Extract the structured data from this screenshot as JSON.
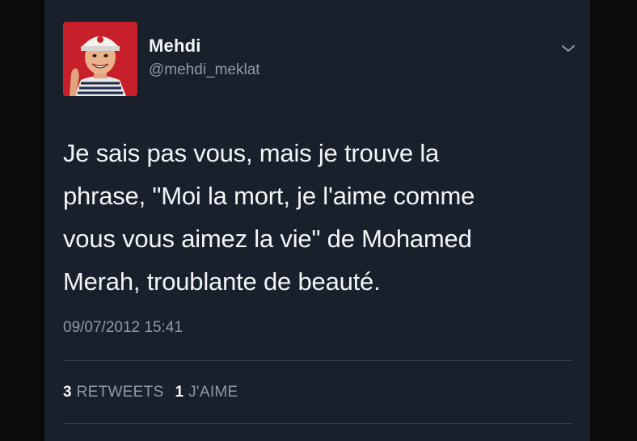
{
  "user": {
    "display_name": "Mehdi",
    "handle": "@mehdi_meklat"
  },
  "tweet": {
    "text": "Je sais pas vous, mais je trouve la\nphrase, \"Moi la mort, je l'aime comme\nvous vous aimez la vie\" de Mohamed\nMerah, troublante de beauté.",
    "timestamp": "09/07/2012 15:41"
  },
  "stats": {
    "retweets_count": "3",
    "retweets_label": "RETWEETS",
    "likes_count": "1",
    "likes_label": "J'AIME"
  },
  "icons": {
    "menu": "chevron-down-icon"
  },
  "colors": {
    "card_background": "#17202b",
    "primary_text": "#f3f5f7",
    "secondary_text": "#8e9aa6",
    "avatar_background": "#c8202a"
  }
}
